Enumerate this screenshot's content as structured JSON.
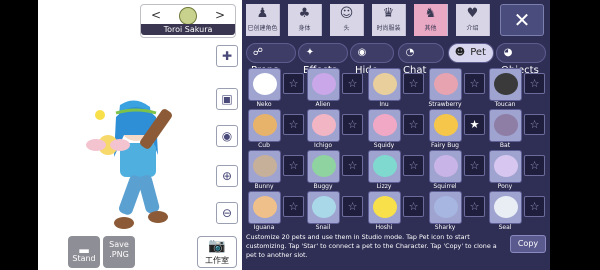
{
  "character": {
    "name": "Toroi Sakura"
  },
  "left_tools": [
    {
      "icon": "add-user-icon",
      "glyph": "✚"
    },
    {
      "icon": "image-icon",
      "glyph": "▣"
    },
    {
      "icon": "eye-icon",
      "glyph": "◉"
    },
    {
      "icon": "zoom-in-icon",
      "glyph": "⊕"
    },
    {
      "icon": "zoom-out-icon",
      "glyph": "⊖"
    }
  ],
  "bottom_buttons": {
    "stand": "Stand",
    "save": "Save .PNG",
    "studio": "工作室"
  },
  "categories": [
    {
      "label": "已创建角色",
      "glyph": "♟"
    },
    {
      "label": "身体",
      "glyph": "♣"
    },
    {
      "label": "头",
      "glyph": "☺"
    },
    {
      "label": "时尚服装",
      "glyph": "♛"
    },
    {
      "label": "其他",
      "glyph": "♞"
    },
    {
      "label": "介绍",
      "glyph": "♥"
    }
  ],
  "close_label": "✕",
  "tabs": [
    {
      "label": "Props",
      "glyph": "☍"
    },
    {
      "label": "Effects",
      "glyph": "✦"
    },
    {
      "label": "Hide",
      "glyph": "◉"
    },
    {
      "label": "Chat",
      "glyph": "◔"
    },
    {
      "label": "Pet",
      "glyph": "☻"
    },
    {
      "label": "Objects",
      "glyph": "◕"
    }
  ],
  "pets": [
    {
      "name": "Neko",
      "color": "#ffffff"
    },
    {
      "name": "Alien",
      "color": "#c9a7e8"
    },
    {
      "name": "Inu",
      "color": "#e9cf9b"
    },
    {
      "name": "Strawberry",
      "color": "#e7a3b0"
    },
    {
      "name": "Toucan",
      "color": "#3a3a3a"
    },
    {
      "name": "Cub",
      "color": "#e7b36b"
    },
    {
      "name": "Ichigo",
      "color": "#f2b5c4"
    },
    {
      "name": "Squidy",
      "color": "#f0a8c4"
    },
    {
      "name": "Fairy Bug",
      "color": "#f5c64a"
    },
    {
      "name": "Bat",
      "color": "#8e7ea6"
    },
    {
      "name": "Bunny",
      "color": "#c7b09a"
    },
    {
      "name": "Buggy",
      "color": "#8fd3a0"
    },
    {
      "name": "Lizzy",
      "color": "#7fd9cf"
    },
    {
      "name": "Squirrel",
      "color": "#c8b4e6"
    },
    {
      "name": "Pony",
      "color": "#d7c7f0"
    },
    {
      "name": "Iguana",
      "color": "#f0c08a"
    },
    {
      "name": "Snail",
      "color": "#a9d9e8"
    },
    {
      "name": "Hoshi",
      "color": "#f7e04a"
    },
    {
      "name": "Sharky",
      "color": "#a6b6e0"
    },
    {
      "name": "Seal",
      "color": "#e9eef5"
    }
  ],
  "star_states": [
    false,
    false,
    false,
    false,
    false,
    false,
    false,
    false,
    true,
    false,
    false,
    false,
    false,
    false,
    false,
    false,
    false,
    false,
    false,
    false
  ],
  "info_text": "Customize 20 pets and use them in Studio mode. Tap Pet icon to start customizing. Tap 'Star' to connect a pet to the Character. Tap 'Copy' to clone a pet to another slot.",
  "copy_label": "Copy",
  "colors": {
    "panel": "#2f2e55",
    "active_category": "#e9a8c4",
    "active_tab": "#d8d6ee"
  }
}
